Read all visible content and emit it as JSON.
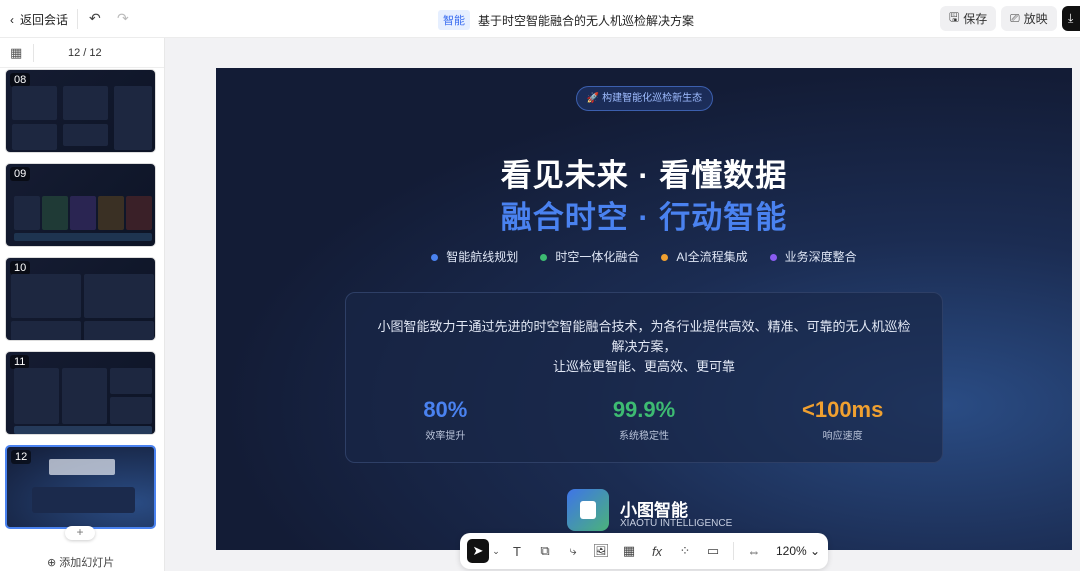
{
  "topbar": {
    "back_label": "返回会话",
    "badge": "智能",
    "title": "基于时空智能融合的无人机巡检解决方案",
    "save_label": "保存",
    "present_label": "放映"
  },
  "sidebar": {
    "page_indicator": "12 / 12",
    "thumbnails": [
      {
        "num": "08"
      },
      {
        "num": "09"
      },
      {
        "num": "10"
      },
      {
        "num": "11"
      },
      {
        "num": "12"
      }
    ],
    "add_slide_label": "添加幻灯片"
  },
  "slide": {
    "pill": "构建智能化巡检新生态",
    "headline1": "看见未来 · 看懂数据",
    "headline2": "融合时空 · 行动智能",
    "tags": [
      {
        "label": "智能航线规划",
        "color": "#4a82f0"
      },
      {
        "label": "时空一体化融合",
        "color": "#3dbb72"
      },
      {
        "label": "AI全流程集成",
        "color": "#f0a030"
      },
      {
        "label": "业务深度整合",
        "color": "#8a5cf0"
      }
    ],
    "description_line1": "小图智能致力于通过先进的时空智能融合技术，为各行业提供高效、精准、可靠的无人机巡检解决方案，",
    "description_line2": "让巡检更智能、更高效、更可靠",
    "stats": [
      {
        "value": "80%",
        "label": "效率提升",
        "color": "#4a82f0"
      },
      {
        "value": "99.9%",
        "label": "系统稳定性",
        "color": "#3dbb72"
      },
      {
        "value": "<100ms",
        "label": "响应速度",
        "color": "#f0a030"
      }
    ],
    "brand_name": "小图智能",
    "brand_en": "XIAOTU INTELLIGENCE"
  },
  "toolbar": {
    "zoom": "120%"
  }
}
